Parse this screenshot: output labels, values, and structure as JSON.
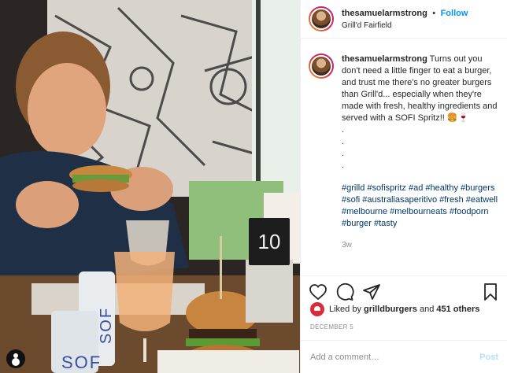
{
  "header": {
    "username": "thesamuelarmstrong",
    "separator": "•",
    "follow_label": "Follow",
    "location": "Grill'd Fairfield"
  },
  "caption": {
    "username": "thesamuelarmstrong",
    "text": "Turns out you don't need a little finger to eat a burger, and trust me there's no greater burgers than Grill'd... especially when they're made with fresh, healthy ingredients and served with a SOFI Spritz!! 🍔🍷",
    "dots": [
      ".",
      ".",
      ".",
      "."
    ],
    "hashtags": "#grilld #sofispritz #ad #healthy #burgers #sofi #australiasaperitivo #fresh #eatwell #melbourne #melbourneats #foodporn #burger #tasty",
    "time_ago": "3w"
  },
  "photo": {
    "table_number": "10",
    "can_text_1": "SOF",
    "can_text_2": "SOF"
  },
  "actions": {
    "icons": [
      "heart-icon",
      "comment-icon",
      "share-icon",
      "bookmark-icon"
    ]
  },
  "likes": {
    "prefix": "Liked by",
    "user": "grilldburgers",
    "and": "and",
    "others": "451 others"
  },
  "date": "DECEMBER 5",
  "add_comment": {
    "placeholder": "Add a comment…",
    "post_label": "Post"
  },
  "colors": {
    "link_blue": "#0095f6",
    "hashtag_blue": "#00376b",
    "grilld_red": "#d92b3a"
  }
}
